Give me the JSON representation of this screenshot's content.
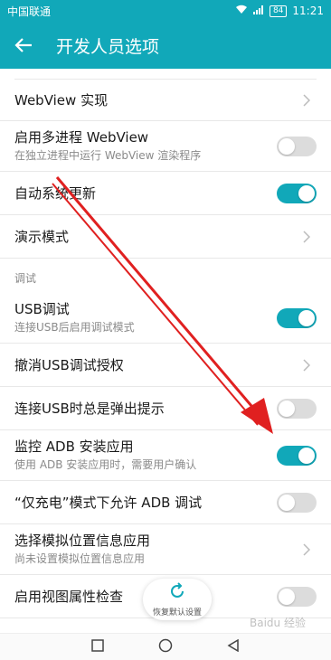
{
  "status": {
    "carrier": "中国联通",
    "battery": "84",
    "time": "11:21"
  },
  "appbar": {
    "title": "开发人员选项"
  },
  "list": {
    "rows": [
      {
        "title": "WebView 实现",
        "control": "chevron"
      },
      {
        "title": "启用多进程 WebView",
        "subtitle": "在独立进程中运行 WebView 渲染程序",
        "control": "toggle",
        "on": false
      },
      {
        "title": "自动系统更新",
        "control": "toggle",
        "on": true
      },
      {
        "title": "演示模式",
        "control": "chevron"
      }
    ],
    "section": "调试",
    "debug_rows": [
      {
        "title": "USB调试",
        "subtitle": "连接USB后启用调试模式",
        "control": "toggle",
        "on": true
      },
      {
        "title": "撤消USB调试授权",
        "control": "chevron"
      },
      {
        "title": "连接USB时总是弹出提示",
        "control": "toggle",
        "on": false
      },
      {
        "title": "监控 ADB 安装应用",
        "subtitle": "使用 ADB 安装应用时，需要用户确认",
        "control": "toggle",
        "on": true
      },
      {
        "title": "“仅充电”模式下允许 ADB 调试",
        "control": "toggle",
        "on": false
      },
      {
        "title": "选择模拟位置信息应用",
        "subtitle": "尚未设置模拟位置信息应用",
        "control": "chevron"
      },
      {
        "title": "启用视图属性检查",
        "control": "toggle",
        "on": false
      }
    ]
  },
  "restore_button": {
    "label": "恢复默认设置"
  },
  "watermark": "Baidu 经验",
  "colors": {
    "accent": "#11a8b9",
    "arrow": "#e02020"
  }
}
